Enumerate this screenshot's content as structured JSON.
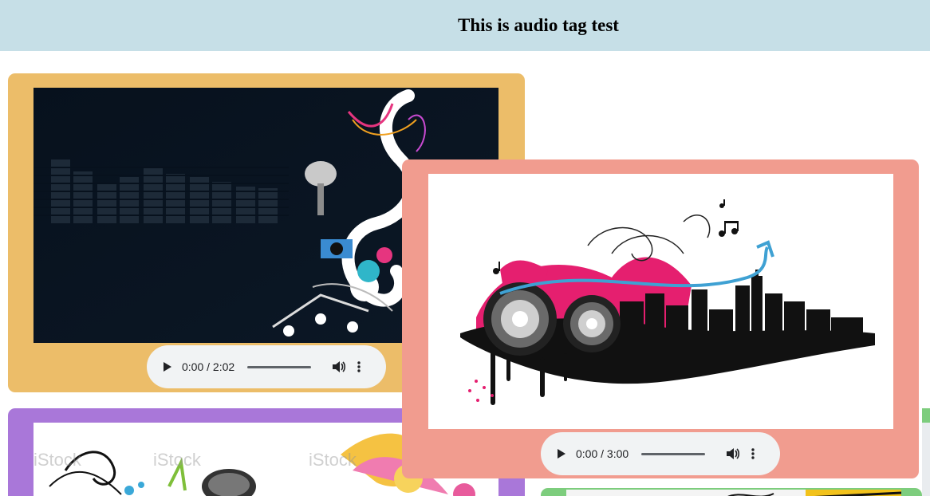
{
  "page": {
    "title": "This is audio tag test"
  },
  "players": [
    {
      "time": "0:00 / 2:02",
      "bg": "#ecbd69"
    },
    {
      "time": "0:00 / 3:00",
      "bg": "#f19c8f"
    }
  ],
  "cards": {
    "card1_color": "#ecbd69",
    "card2_color": "#f19c8f",
    "card3_color": "#a977d9",
    "card4_color": "#7dcd7d"
  },
  "icons": {
    "play": "play-icon",
    "volume": "volume-icon",
    "more": "more-options-icon"
  },
  "watermarks": [
    "iStock",
    "iStock",
    "iStock"
  ]
}
